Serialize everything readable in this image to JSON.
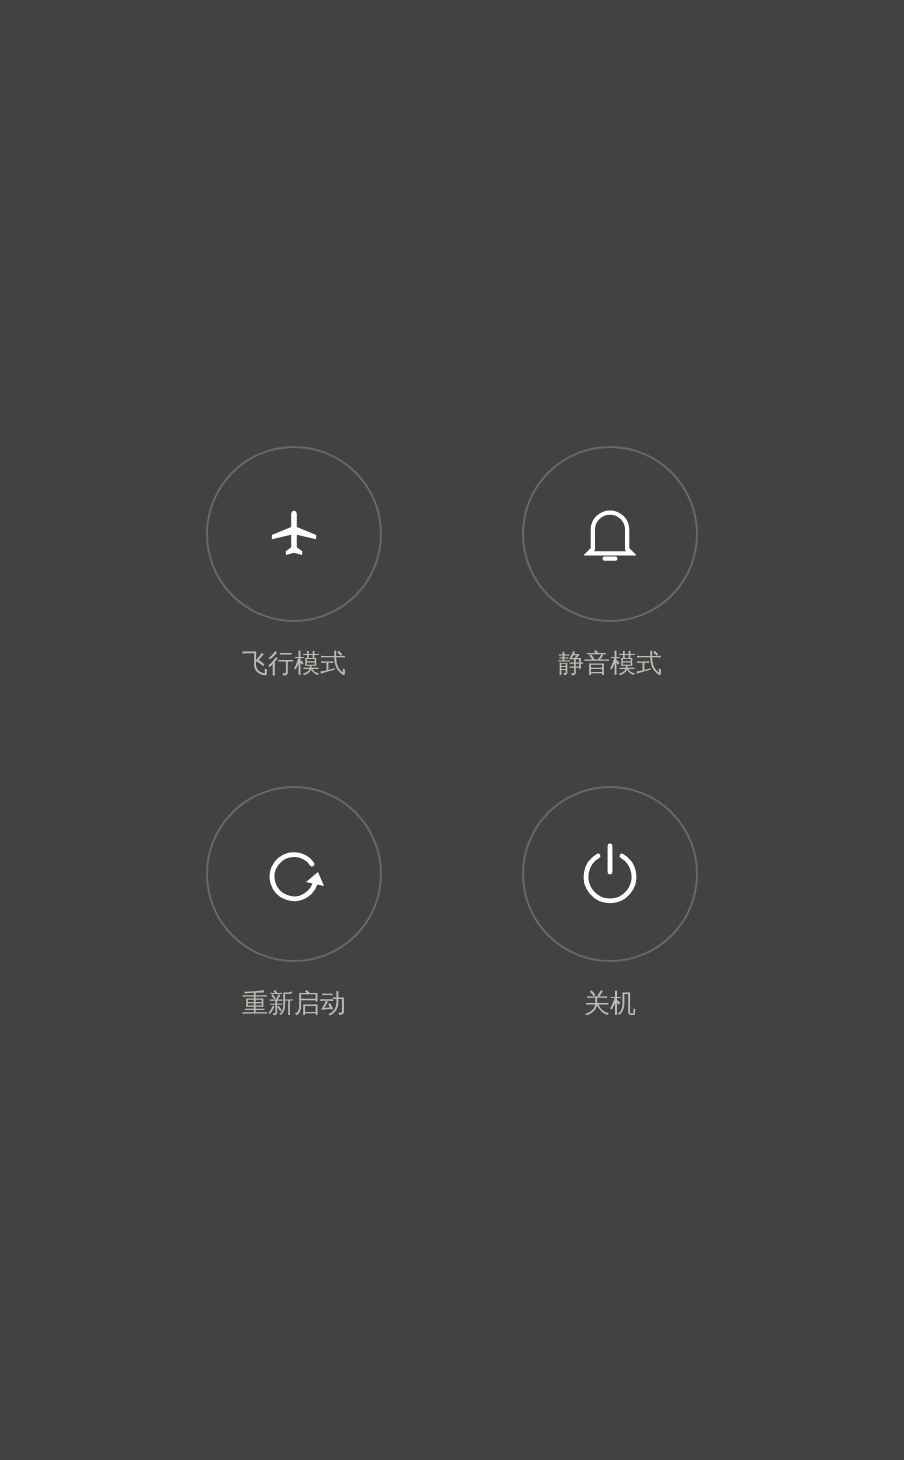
{
  "actions": [
    {
      "kind": "airplane",
      "label": "飞行模式"
    },
    {
      "kind": "bell",
      "label": "静音模式"
    },
    {
      "kind": "restart",
      "label": "重新启动"
    },
    {
      "kind": "power",
      "label": "关机"
    }
  ]
}
